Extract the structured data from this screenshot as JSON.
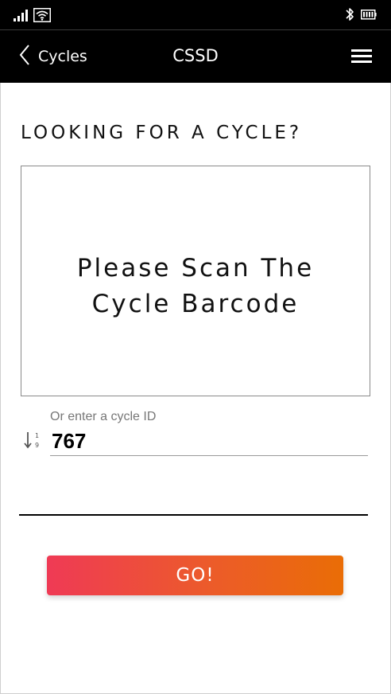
{
  "status_bar": {
    "icons": [
      "signal-icon",
      "wifi-icon",
      "bluetooth-icon",
      "battery-icon"
    ]
  },
  "app_bar": {
    "back_label": "Cycles",
    "title": "CSSD",
    "menu_icon": "hamburger-menu-icon"
  },
  "main": {
    "section_title": "LOOKING FOR A CYCLE?",
    "scan_prompt": "Please Scan The\nCycle Barcode",
    "cycle_id_label": "Or enter a cycle ID",
    "cycle_id_value": "767",
    "cycle_id_icon": "sort-numeric-icon",
    "go_label": "GO!"
  },
  "colors": {
    "app_bar_background": "#000000",
    "button_gradient_start": "#ef3a55",
    "button_gradient_end": "#ea6d06",
    "label_gray": "#777777"
  }
}
